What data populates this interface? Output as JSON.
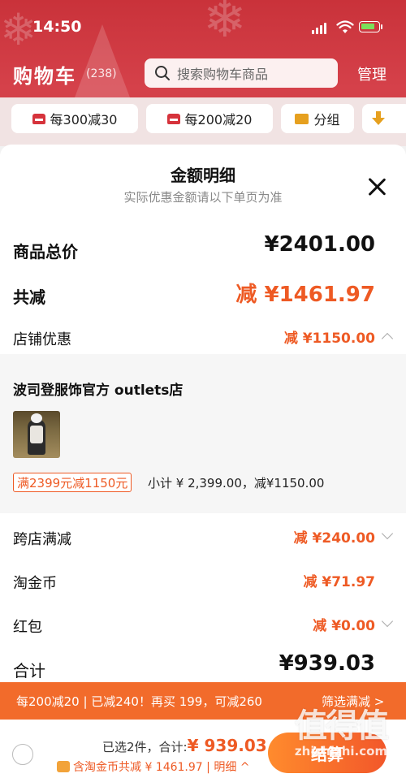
{
  "status_bar": {
    "time": "14:50"
  },
  "header": {
    "title": "购物车",
    "count": "(238)",
    "search_placeholder": "搜索购物车商品",
    "manage": "管理"
  },
  "promo_tabs": [
    {
      "label": "每300减30",
      "icon": "promo-tag-icon"
    },
    {
      "label": "每200减20",
      "icon": "promo-tag-icon"
    },
    {
      "label": "分组",
      "icon": "folder-icon"
    }
  ],
  "sheet": {
    "title": "金额明细",
    "subtitle": "实际优惠金额请以下单页为准",
    "total_price": {
      "label": "商品总价",
      "value": "¥2401.00"
    },
    "total_discount": {
      "label": "共减",
      "value": "减 ¥1461.97"
    },
    "shop_discount": {
      "label": "店铺优惠",
      "value": "减 ¥1150.00"
    },
    "shop": {
      "name": "波司登服饰官方 outlets店",
      "coupon": "满2399元减1150元",
      "subtotal": "小计 ¥ 2,399.00，减¥1150.00"
    },
    "cross_store": {
      "label": "跨店满减",
      "value": "减 ¥240.00"
    },
    "gold_coin": {
      "label": "淘金币",
      "value": "减 ¥71.97"
    },
    "red_packet": {
      "label": "红包",
      "value": "减 ¥0.00"
    },
    "total": {
      "label": "合计",
      "value": "¥939.03"
    }
  },
  "promo_bar": {
    "text": "每200减20 | 已减240！再买 199，可减260",
    "link": "筛选满减 >"
  },
  "bottom_bar": {
    "selected": "已选2件，合计:",
    "amount": "¥ 939.03",
    "gold_note": "含淘金币共减 ¥ 1461.97 | 明细 ^",
    "settle": "结算"
  },
  "watermark": {
    "logo": "值得值",
    "url": "zhizhizhi.com"
  },
  "colors": {
    "accent": "#ee5a24",
    "header_red": "#d5414a",
    "promo_orange": "#f26b2b"
  }
}
